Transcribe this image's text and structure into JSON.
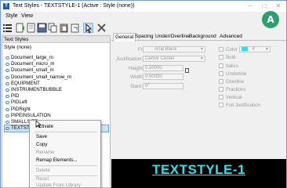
{
  "window": {
    "title": "Text Styles - TEXTSTYLE-1 (Active : Style (none))"
  },
  "badge": {
    "label": "A",
    "color": "#2e9e6e"
  },
  "menu": {
    "style": "Style",
    "view": "View"
  },
  "toolbar": {
    "icons": [
      "list-view-icon",
      "new-style-icon",
      "open-icon",
      "save-icon",
      "copy-icon",
      "paste-icon",
      "select-style-icon",
      "delete-icon"
    ]
  },
  "left_panel": {
    "header": "Text Styles",
    "group": "Style (none)",
    "items": [
      "Document_large_m",
      "Document_micro_m",
      "Document_small_m",
      "Document_small_narrow_m",
      "EQUIPMENT",
      "INSTRUMENTBUBBLE",
      "PID",
      "PIDLeft",
      "PIDRight",
      "PIPEINSULATION",
      "SMALLSIZE",
      "TEXTSTY"
    ],
    "selected_index": 11
  },
  "context_menu": {
    "activate": "Activate",
    "save": "Save",
    "copy": "Copy",
    "rename": "Rename",
    "remap": "Remap Elements...",
    "delete": "Delete",
    "reset": "Reset",
    "update_from_library": "Update From Library"
  },
  "tabs": [
    "General",
    "Spacing",
    "Under/Overline",
    "Background",
    "Advanced"
  ],
  "active_tab": 0,
  "general": {
    "font_label": "Font:",
    "font_value": "Arial Black",
    "justification_label": "Justification:",
    "justification_value": "Center Center",
    "height_label": "Height:",
    "height_value": "0.50000",
    "width_label": "Width:",
    "width_value": "0.50000",
    "slant_label": "Slant:",
    "slant_value": "0°",
    "color_label": "Color",
    "color_value": "4",
    "bold": "Bold",
    "italics": "Italics",
    "underline": "Underline",
    "overline": "Overline",
    "fractions": "Fractions",
    "vertical": "Vertical",
    "full_justification": "Full Justification"
  },
  "preview": {
    "text": "TEXTSTYLE-1",
    "color": "#2fe0e8"
  }
}
